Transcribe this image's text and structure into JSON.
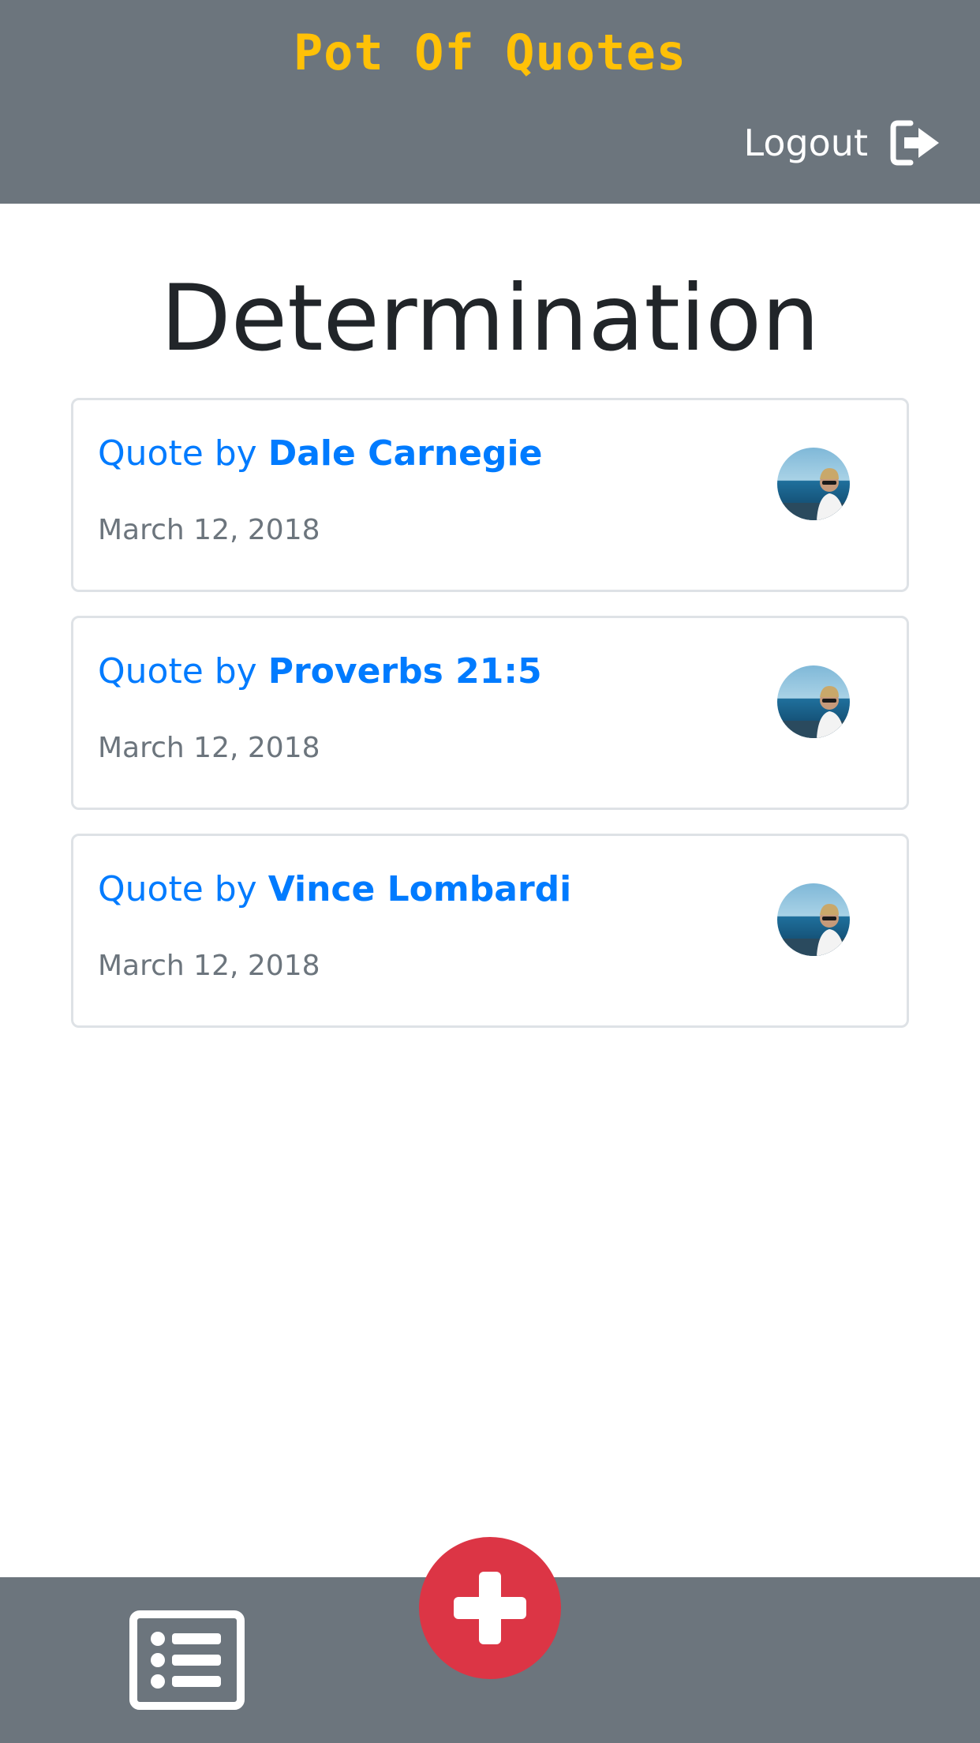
{
  "header": {
    "brand": "Pot Of Quotes",
    "logout_label": "Logout",
    "logout_icon": "sign-out-icon"
  },
  "main": {
    "title": "Determination",
    "quotes": [
      {
        "prefix": "Quote by",
        "author": "Dale Carnegie",
        "date": "March 12, 2018"
      },
      {
        "prefix": "Quote by",
        "author": "Proverbs 21:5",
        "date": "March 12, 2018"
      },
      {
        "prefix": "Quote by",
        "author": "Vince Lombardi",
        "date": "March 12, 2018"
      }
    ]
  },
  "footer": {
    "list_icon": "list-icon",
    "add_icon": "plus-icon"
  },
  "colors": {
    "header_bg": "#6c757d",
    "brand": "#ffc107",
    "link": "#007bff",
    "muted": "#6c757d",
    "add_button": "#dc3545",
    "title": "#212529"
  }
}
